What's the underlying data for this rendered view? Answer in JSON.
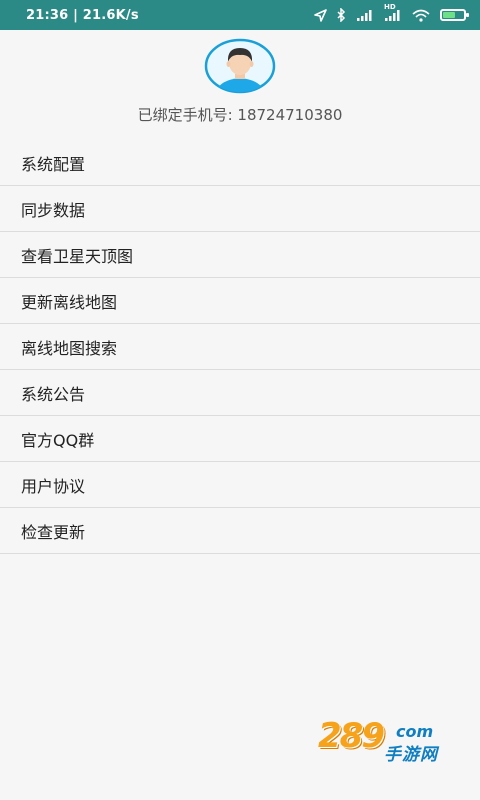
{
  "status_bar": {
    "time_speed": "21:36 | 21.6K/s",
    "network_label": "HD"
  },
  "profile": {
    "avatar_icon": "user-avatar-icon",
    "phone_label": "已绑定手机号:",
    "phone_number": "18724710380"
  },
  "menu": {
    "items": [
      {
        "label": "系统配置"
      },
      {
        "label": "同步数据"
      },
      {
        "label": "查看卫星天顶图"
      },
      {
        "label": "更新离线地图"
      },
      {
        "label": "离线地图搜索"
      },
      {
        "label": "系统公告"
      },
      {
        "label": "官方QQ群"
      },
      {
        "label": "用户协议"
      },
      {
        "label": "检查更新"
      }
    ]
  },
  "watermark": {
    "number": "289",
    "domain": "com",
    "sub": "手游网"
  },
  "colors": {
    "status_bar": "#2c8a86",
    "background": "#f6f6f6",
    "avatar_ring": "#1aa0d8",
    "divider": "#dcdcdc"
  }
}
